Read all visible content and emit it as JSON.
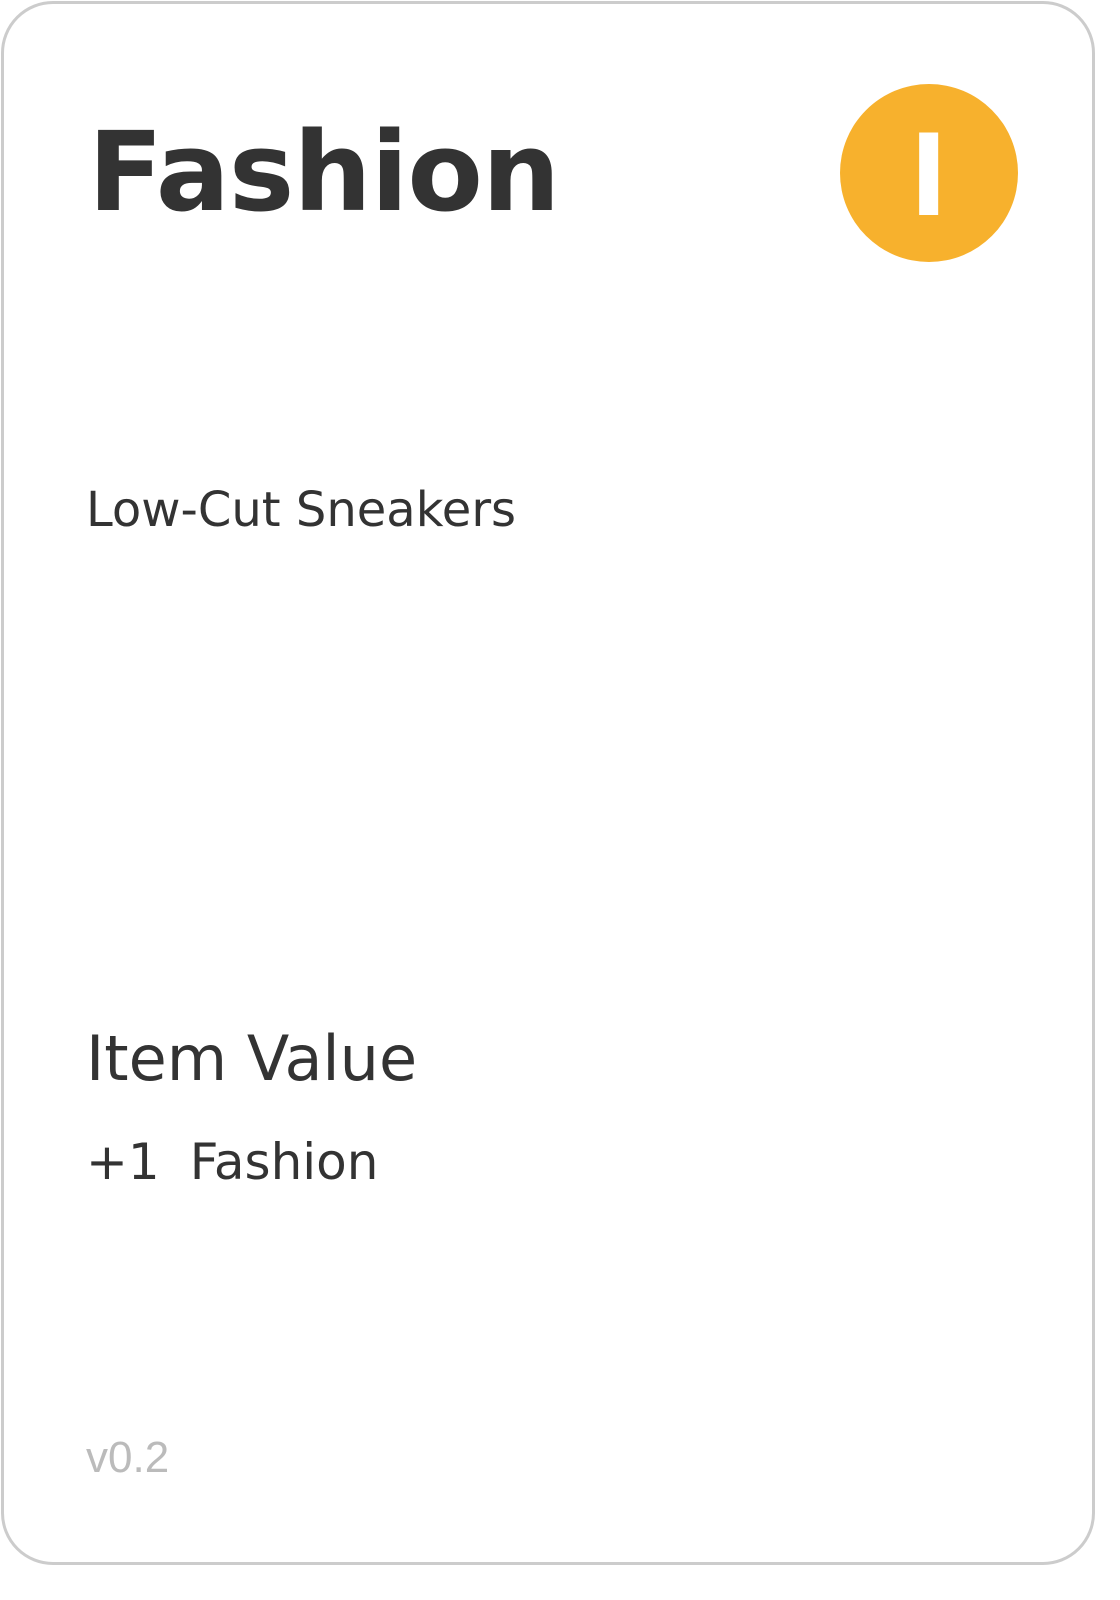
{
  "card": {
    "title": "Fashion",
    "badge": {
      "letter": "I",
      "color": "#f7b12d"
    },
    "item_name": "Low-Cut Sneakers",
    "value_section": {
      "heading": "Item Value",
      "stats": [
        {
          "amount": "+1",
          "label": "Fashion"
        }
      ]
    },
    "version": "v0.2"
  }
}
